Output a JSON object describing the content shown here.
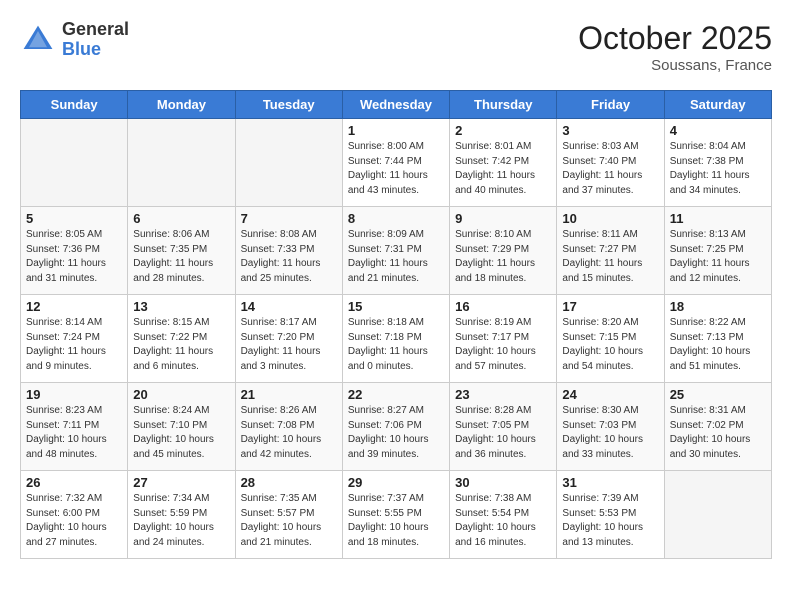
{
  "header": {
    "logo_general": "General",
    "logo_blue": "Blue",
    "title": "October 2025",
    "subtitle": "Soussans, France"
  },
  "days_of_week": [
    "Sunday",
    "Monday",
    "Tuesday",
    "Wednesday",
    "Thursday",
    "Friday",
    "Saturday"
  ],
  "weeks": [
    [
      {
        "day": "",
        "info": ""
      },
      {
        "day": "",
        "info": ""
      },
      {
        "day": "",
        "info": ""
      },
      {
        "day": "1",
        "info": "Sunrise: 8:00 AM\nSunset: 7:44 PM\nDaylight: 11 hours\nand 43 minutes."
      },
      {
        "day": "2",
        "info": "Sunrise: 8:01 AM\nSunset: 7:42 PM\nDaylight: 11 hours\nand 40 minutes."
      },
      {
        "day": "3",
        "info": "Sunrise: 8:03 AM\nSunset: 7:40 PM\nDaylight: 11 hours\nand 37 minutes."
      },
      {
        "day": "4",
        "info": "Sunrise: 8:04 AM\nSunset: 7:38 PM\nDaylight: 11 hours\nand 34 minutes."
      }
    ],
    [
      {
        "day": "5",
        "info": "Sunrise: 8:05 AM\nSunset: 7:36 PM\nDaylight: 11 hours\nand 31 minutes."
      },
      {
        "day": "6",
        "info": "Sunrise: 8:06 AM\nSunset: 7:35 PM\nDaylight: 11 hours\nand 28 minutes."
      },
      {
        "day": "7",
        "info": "Sunrise: 8:08 AM\nSunset: 7:33 PM\nDaylight: 11 hours\nand 25 minutes."
      },
      {
        "day": "8",
        "info": "Sunrise: 8:09 AM\nSunset: 7:31 PM\nDaylight: 11 hours\nand 21 minutes."
      },
      {
        "day": "9",
        "info": "Sunrise: 8:10 AM\nSunset: 7:29 PM\nDaylight: 11 hours\nand 18 minutes."
      },
      {
        "day": "10",
        "info": "Sunrise: 8:11 AM\nSunset: 7:27 PM\nDaylight: 11 hours\nand 15 minutes."
      },
      {
        "day": "11",
        "info": "Sunrise: 8:13 AM\nSunset: 7:25 PM\nDaylight: 11 hours\nand 12 minutes."
      }
    ],
    [
      {
        "day": "12",
        "info": "Sunrise: 8:14 AM\nSunset: 7:24 PM\nDaylight: 11 hours\nand 9 minutes."
      },
      {
        "day": "13",
        "info": "Sunrise: 8:15 AM\nSunset: 7:22 PM\nDaylight: 11 hours\nand 6 minutes."
      },
      {
        "day": "14",
        "info": "Sunrise: 8:17 AM\nSunset: 7:20 PM\nDaylight: 11 hours\nand 3 minutes."
      },
      {
        "day": "15",
        "info": "Sunrise: 8:18 AM\nSunset: 7:18 PM\nDaylight: 11 hours\nand 0 minutes."
      },
      {
        "day": "16",
        "info": "Sunrise: 8:19 AM\nSunset: 7:17 PM\nDaylight: 10 hours\nand 57 minutes."
      },
      {
        "day": "17",
        "info": "Sunrise: 8:20 AM\nSunset: 7:15 PM\nDaylight: 10 hours\nand 54 minutes."
      },
      {
        "day": "18",
        "info": "Sunrise: 8:22 AM\nSunset: 7:13 PM\nDaylight: 10 hours\nand 51 minutes."
      }
    ],
    [
      {
        "day": "19",
        "info": "Sunrise: 8:23 AM\nSunset: 7:11 PM\nDaylight: 10 hours\nand 48 minutes."
      },
      {
        "day": "20",
        "info": "Sunrise: 8:24 AM\nSunset: 7:10 PM\nDaylight: 10 hours\nand 45 minutes."
      },
      {
        "day": "21",
        "info": "Sunrise: 8:26 AM\nSunset: 7:08 PM\nDaylight: 10 hours\nand 42 minutes."
      },
      {
        "day": "22",
        "info": "Sunrise: 8:27 AM\nSunset: 7:06 PM\nDaylight: 10 hours\nand 39 minutes."
      },
      {
        "day": "23",
        "info": "Sunrise: 8:28 AM\nSunset: 7:05 PM\nDaylight: 10 hours\nand 36 minutes."
      },
      {
        "day": "24",
        "info": "Sunrise: 8:30 AM\nSunset: 7:03 PM\nDaylight: 10 hours\nand 33 minutes."
      },
      {
        "day": "25",
        "info": "Sunrise: 8:31 AM\nSunset: 7:02 PM\nDaylight: 10 hours\nand 30 minutes."
      }
    ],
    [
      {
        "day": "26",
        "info": "Sunrise: 7:32 AM\nSunset: 6:00 PM\nDaylight: 10 hours\nand 27 minutes."
      },
      {
        "day": "27",
        "info": "Sunrise: 7:34 AM\nSunset: 5:59 PM\nDaylight: 10 hours\nand 24 minutes."
      },
      {
        "day": "28",
        "info": "Sunrise: 7:35 AM\nSunset: 5:57 PM\nDaylight: 10 hours\nand 21 minutes."
      },
      {
        "day": "29",
        "info": "Sunrise: 7:37 AM\nSunset: 5:55 PM\nDaylight: 10 hours\nand 18 minutes."
      },
      {
        "day": "30",
        "info": "Sunrise: 7:38 AM\nSunset: 5:54 PM\nDaylight: 10 hours\nand 16 minutes."
      },
      {
        "day": "31",
        "info": "Sunrise: 7:39 AM\nSunset: 5:53 PM\nDaylight: 10 hours\nand 13 minutes."
      },
      {
        "day": "",
        "info": ""
      }
    ]
  ]
}
